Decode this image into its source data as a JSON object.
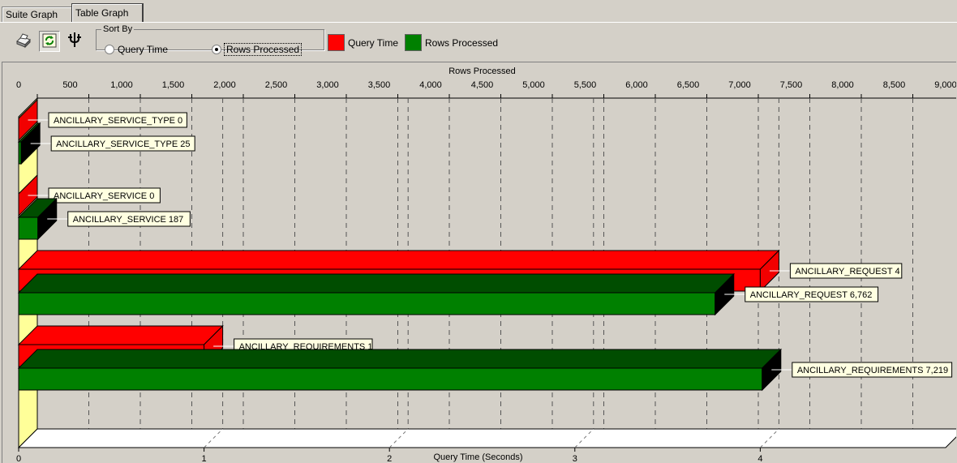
{
  "tabs": [
    {
      "label": "Suite Graph",
      "active": false
    },
    {
      "label": "Table Graph",
      "active": true
    }
  ],
  "toolbar": {
    "buttons": [
      {
        "name": "print-icon"
      },
      {
        "name": "refresh-icon"
      },
      {
        "name": "filter-icon"
      }
    ],
    "sort_by": {
      "label": "Sort By",
      "options": [
        "Query Time",
        "Rows Processed"
      ],
      "selected": "Rows Processed"
    },
    "legend": [
      {
        "label": "Query Time",
        "color": "#ff0000"
      },
      {
        "label": "Rows Processed",
        "color": "#008000"
      }
    ]
  },
  "chart_data": {
    "type": "bar",
    "orientation": "horizontal",
    "style": "3d",
    "categories": [
      "ANCILLARY_SERVICE_TYPE",
      "ANCILLARY_SERVICE",
      "ANCILLARY_REQUEST",
      "ANCILLARY_REQUIREMENTS"
    ],
    "series": [
      {
        "name": "Query Time",
        "axis": "bottom",
        "color": "#ff0000",
        "values": [
          0,
          0,
          4,
          1
        ],
        "labels": [
          "ANCILLARY_SERVICE_TYPE 0",
          "ANCILLARY_SERVICE 0",
          "ANCILLARY_REQUEST 4",
          "ANCILLARY_REQUIREMENTS 1"
        ]
      },
      {
        "name": "Rows Processed",
        "axis": "top",
        "color": "#008000",
        "values": [
          25,
          187,
          6762,
          7219
        ],
        "labels": [
          "ANCILLARY_SERVICE_TYPE 25",
          "ANCILLARY_SERVICE 187",
          "ANCILLARY_REQUEST 6,762",
          "ANCILLARY_REQUIREMENTS 7,219"
        ]
      }
    ],
    "top_axis": {
      "label": "Rows Processed",
      "range": [
        0,
        9000
      ],
      "ticks": [
        "0",
        "500",
        "1,000",
        "1,500",
        "2,000",
        "2,500",
        "3,000",
        "3,500",
        "4,000",
        "4,500",
        "5,000",
        "5,500",
        "6,000",
        "6,500",
        "7,000",
        "7,500",
        "8,000",
        "8,500",
        "9,000"
      ]
    },
    "bottom_axis": {
      "label": "Query Time (Seconds)",
      "range": [
        0,
        5
      ],
      "ticks": [
        "0",
        "1",
        "2",
        "3",
        "4"
      ]
    },
    "grid": true,
    "legend_placement": "toolbar"
  }
}
